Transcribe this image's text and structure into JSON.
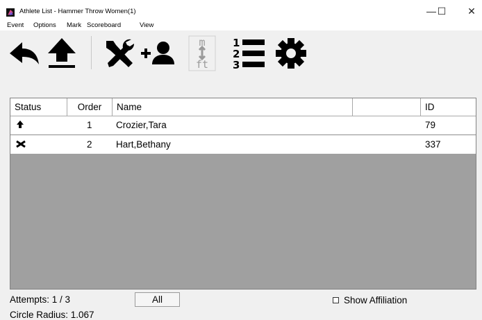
{
  "window": {
    "title": "Athlete List - Hammer Throw Women(1)",
    "minimize_glyph": "—",
    "maximize_glyph": "☐",
    "close_glyph": "✕"
  },
  "menu": [
    "Event",
    "Options",
    "Mark",
    "Scoreboard",
    "View"
  ],
  "toolbar": {
    "buttons": [
      "back-arrow-icon",
      "upload-arrow-icon",
      "tools-icon",
      "add-athlete-icon",
      "metric-feet-toggle-icon",
      "numbered-list-icon",
      "gear-icon"
    ],
    "unit_top": "m",
    "unit_bottom": "ft"
  },
  "table": {
    "columns": [
      "Status",
      "Order",
      "Name",
      "",
      "ID"
    ],
    "rows": [
      {
        "status_icon": "up-arrow-icon",
        "order": "1",
        "name": "Crozier,Tara",
        "extra": "",
        "id": "79"
      },
      {
        "status_icon": "cross-hammers-icon",
        "order": "2",
        "name": "Hart,Bethany",
        "extra": "",
        "id": "337"
      }
    ]
  },
  "footer": {
    "attempts": "Attempts: 1 / 3",
    "all_button": "All",
    "show_affiliation_label": "Show Affiliation",
    "show_affiliation_checked": false,
    "circle_radius": "Circle Radius: 1.067"
  },
  "colors": {
    "table_background": "#a0a0a0",
    "window_background": "#f0f0f0"
  }
}
